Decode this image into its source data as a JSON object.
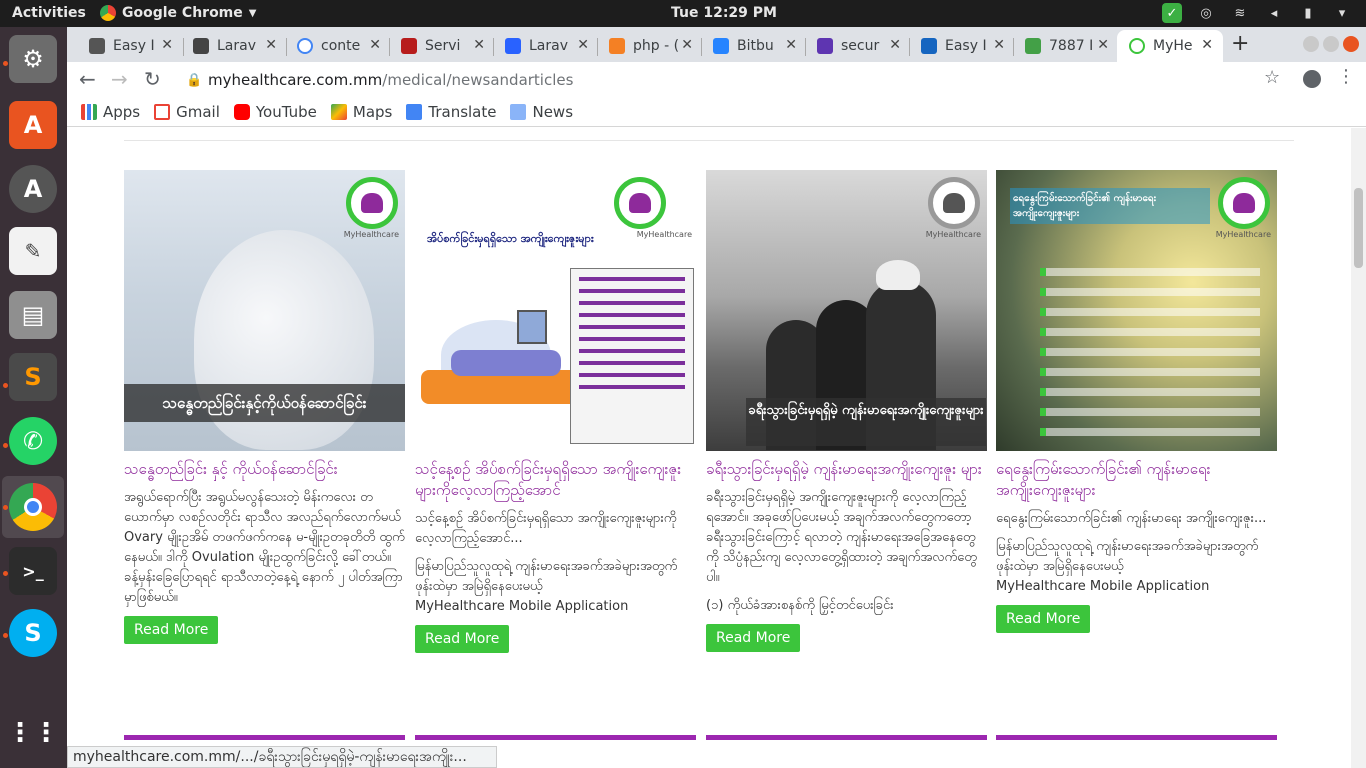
{
  "topbar": {
    "activities": "Activities",
    "app": "Google Chrome",
    "clock": "Tue 12:29 PM"
  },
  "tabs": [
    {
      "label": "Easy I",
      "color": "#555"
    },
    {
      "label": "Larav",
      "color": "#444"
    },
    {
      "label": "conte",
      "color": "#4285f4"
    },
    {
      "label": "Servi",
      "color": "#b71c1c"
    },
    {
      "label": "Larav",
      "color": "#2962ff"
    },
    {
      "label": "php - (",
      "color": "#f48024"
    },
    {
      "label": "Bitbu",
      "color": "#2684ff"
    },
    {
      "label": "secur",
      "color": "#5e35b1"
    },
    {
      "label": "Easy I",
      "color": "#1565c0"
    },
    {
      "label": "7887 I",
      "color": "#43a047"
    },
    {
      "label": "MyHe",
      "color": "#3cc53c"
    }
  ],
  "toolbar": {
    "url_host": "myhealthcare.com.mm",
    "url_path": "/medical/newsandarticles"
  },
  "bookmarks": [
    {
      "label": "Apps",
      "color": "#4285f4"
    },
    {
      "label": "Gmail",
      "color": "#ea4335"
    },
    {
      "label": "YouTube",
      "color": "#ff0000"
    },
    {
      "label": "Maps",
      "color": "#34a853"
    },
    {
      "label": "Translate",
      "color": "#4285f4"
    },
    {
      "label": "News",
      "color": "#4285f4"
    }
  ],
  "cards": [
    {
      "caption": "သန္ဓေတည်ခြင်းနှင့်ကိုယ်ဝန်ဆောင်ခြင်း",
      "title": "သန္ဓေတည်ခြင်း နှင့် ကိုယ်ဝန်ဆောင်ခြင်း",
      "excerpt": "အရွယ်ရောက်ပြီး အရွယ်မလွန်သေးတဲ့ မိန်းကလေး တယောက်မှာ လစဉ်လတိုင်း ရာသီလ အလည်ရက်လောက်မယ် Ovary မျိုးဥအိမ် တဖက်ဖက်ကနေ မ-မျိုးဥတခုတိတိ ထွက်နေမယ်။ ဒါကို Ovulation မျိုးဥထွက်ခြင်းလို့ ခေါ်တယ်။ ခန့်မှန်းခြေပြောရရင် ရာသီလာတဲ့နေ့ရဲ့ နောက် ၂ ပါတ်အကြာမှာဖြစ်မယ်။",
      "extra": "",
      "extra2": "",
      "read_more": "Read More"
    },
    {
      "caption": "",
      "title": "သင့်နေ့စဉ် အိပ်စက်ခြင်းမှရရှိသော အကျိုးကျေးဇူးများကိုလေ့လာကြည့်အောင်",
      "excerpt": "သင့်နေ့စဉ် အိပ်စက်ခြင်းမှရရှိသော အကျိုးကျေးဇူးများကိုလေ့လာကြည့်အောင်...",
      "extra": "မြန်မာပြည်သူလူထုရဲ့ ကျန်းမာရေးအခက်အခဲများအတွက် ဖုန်းထဲမှာ အမြဲရှိနေပေးမယ့်",
      "extra2": "MyHealthcare Mobile Application",
      "read_more": "Read More",
      "img_heading": "အိပ်စက်ခြင်းမှရရှိသော အကျိုးကျေးဇူးများ"
    },
    {
      "caption": "ခရီးသွားခြင်းမှရရှိမဲ့ ကျန်းမာရေးအကျိုးကျေးဇူးများ",
      "title": "ခရီးသွားခြင်းမှရရှိမဲ့ ကျန်းမာရေးအကျိုးကျေးဇူး များ",
      "excerpt": "ခရီးသွားခြင်းမှရရှိမဲ့ အကျိုးကျေးဇူးများကို လေ့လာကြည့်ရအောင်။ အခုဖော်ပြပေးမယ့် အချက်အလက်တွေကတော့ ခရီးသွားခြင်းကြောင့် ရလာတဲ့ ကျန်းမာရေးအခြေအနေတွေကို သိပ္ပံနည်းကျ လေ့လာတွေ့ရှိထားတဲ့ အချက်အလက်တွေ ပါ။",
      "extra": "(၁) ကိုယ်ခံအားစနစ်ကို မြှင့်တင်ပေးခြင်း",
      "extra2": "",
      "read_more": "Read More"
    },
    {
      "caption": "",
      "title": "ရေနွေးကြမ်းသောက်ခြင်း၏ ကျန်းမာရေး အကျိုးကျေးဇူးများ",
      "excerpt": "ရေနွေးကြမ်းသောက်ခြင်း၏ ကျန်းမာရေး အကျိုးကျေးဇူး...",
      "extra": "မြန်မာပြည်သူလူထုရဲ့ ကျန်းမာရေးအခက်အခဲများအတွက် ဖုန်းထဲမှာ အမြဲရှိနေပေးမယ့်",
      "extra2": "MyHealthcare Mobile Application",
      "read_more": "Read More",
      "img_heading": "ရေနွေးကြမ်းသောက်ခြင်း၏ ကျန်းမာရေးအကျိုးကျေးဇူးများ"
    }
  ],
  "logo_label": "MyHealthcare",
  "status_url": "myhealthcare.com.mm/.../ခရီးသွားခြင်းမှရရှိမဲ့-ကျန်းမာရေးအကျိုး..."
}
